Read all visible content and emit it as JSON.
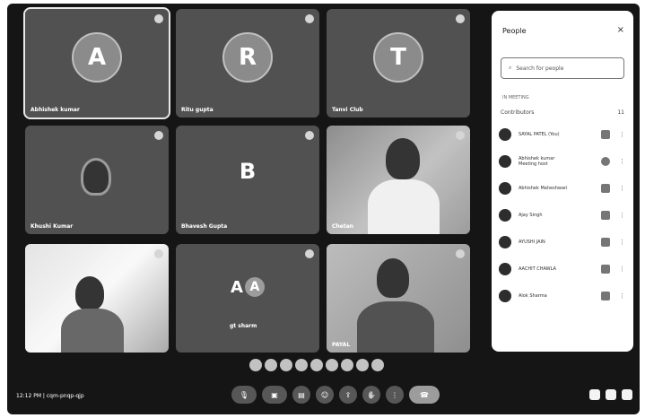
{
  "tiles": [
    {
      "id": "t1",
      "name": "Abhishek kumar",
      "letter": "A"
    },
    {
      "id": "t2",
      "name": "Ritu gupta",
      "letter": "R"
    },
    {
      "id": "t3",
      "name": "Tanvi Club",
      "letter": "T"
    },
    {
      "id": "t4",
      "name": "Khushi Kumar",
      "letter": ""
    },
    {
      "id": "t5",
      "name": "Bhavesh Gupta",
      "letter": "B"
    },
    {
      "id": "t6",
      "name": "Chetan",
      "letter": ""
    },
    {
      "id": "t7",
      "name": "",
      "letter": ""
    },
    {
      "id": "t8",
      "name": "gt sharm",
      "letter": "A"
    },
    {
      "id": "t9",
      "name": "PAYAL",
      "letter": ""
    }
  ],
  "people": {
    "title": "People",
    "close": "×",
    "search_placeholder": "Search for people",
    "section": "IN MEETING",
    "group_label": "Contributors",
    "group_count": "11",
    "list": [
      {
        "name": "SAYAL PATEL (You)",
        "sub": ""
      },
      {
        "name": "Abhishek kumar",
        "sub": "Meeting host"
      },
      {
        "name": "Abhishek Maheshwari",
        "sub": ""
      },
      {
        "name": "Ajay Singh",
        "sub": ""
      },
      {
        "name": "AYUSHI JAIN",
        "sub": ""
      },
      {
        "name": "AACHIT CHAWLA",
        "sub": ""
      },
      {
        "name": "Alok Sharma",
        "sub": ""
      }
    ]
  },
  "status": {
    "time": "12:12 PM",
    "meeting_code": "cqm-pnqp-qjp"
  }
}
